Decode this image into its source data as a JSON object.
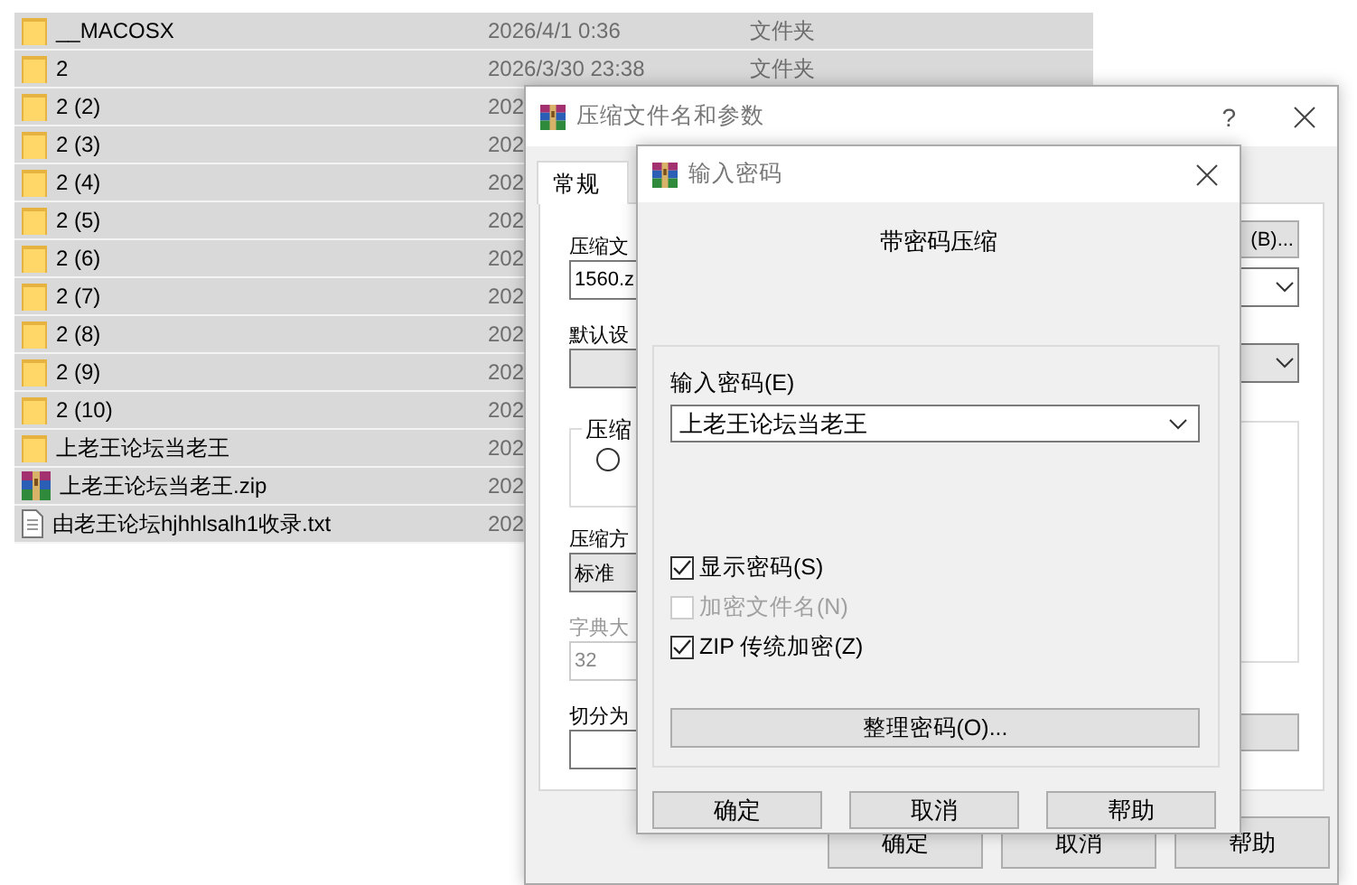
{
  "file_list": {
    "rows": [
      {
        "kind": "folder",
        "name": "__MACOSX",
        "date": "2026/4/1 0:36",
        "type": "文件夹"
      },
      {
        "kind": "folder",
        "name": "2",
        "date": "2026/3/30 23:38",
        "type": "文件夹"
      },
      {
        "kind": "folder",
        "name": "2 (2)",
        "date": "202"
      },
      {
        "kind": "folder",
        "name": "2 (3)",
        "date": "202"
      },
      {
        "kind": "folder",
        "name": "2 (4)",
        "date": "202"
      },
      {
        "kind": "folder",
        "name": "2 (5)",
        "date": "202"
      },
      {
        "kind": "folder",
        "name": "2 (6)",
        "date": "202"
      },
      {
        "kind": "folder",
        "name": "2 (7)",
        "date": "202"
      },
      {
        "kind": "folder",
        "name": "2 (8)",
        "date": "202"
      },
      {
        "kind": "folder",
        "name": "2 (9)",
        "date": "202"
      },
      {
        "kind": "folder",
        "name": "2 (10)",
        "date": "202"
      },
      {
        "kind": "folder",
        "name": "上老王论坛当老王",
        "date": "202"
      },
      {
        "kind": "archive",
        "name": "上老王论坛当老王.zip",
        "date": "202"
      },
      {
        "kind": "text",
        "name": "由老王论坛hjhhlsalh1收录.txt",
        "date": "202"
      }
    ]
  },
  "archive_dialog": {
    "title": "压缩文件名和参数",
    "help": "?",
    "tabs": [
      {
        "label": "常规",
        "selected": true
      }
    ],
    "archive_name_label": "压缩文",
    "archive_name_value": "1560.z",
    "browse_button": "(B)...",
    "profile_label": "默认设",
    "format_group_label": "压缩",
    "format_radio": {
      "selected": false
    },
    "method_label": "压缩方",
    "method_value": "标准",
    "dictionary_label": "字典大",
    "dictionary_value": "32",
    "dictionary_disabled": true,
    "split_label": "切分为",
    "buttons": [
      "确定",
      "取消",
      "帮助"
    ]
  },
  "password_dialog": {
    "title": "输入密码",
    "heading": "带密码压缩",
    "password_label": "输入密码(E)",
    "password_value": "上老王论坛当老王",
    "options": [
      {
        "label": "显示密码(S)",
        "checked": true,
        "disabled": false
      },
      {
        "label": "加密文件名(N)",
        "checked": false,
        "disabled": true
      },
      {
        "label": "ZIP 传统加密(Z)",
        "checked": true,
        "disabled": false
      }
    ],
    "organize_button": "整理密码(O)...",
    "buttons": [
      "确定",
      "取消",
      "帮助"
    ]
  }
}
